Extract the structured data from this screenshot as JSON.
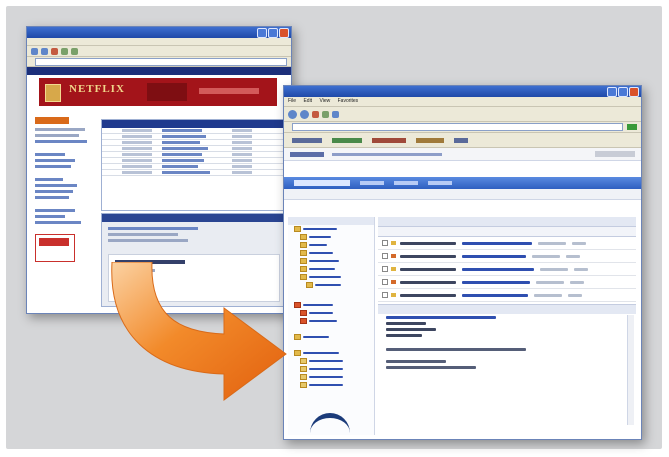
{
  "colors": {
    "netflix_red": "#a3141a",
    "window_blue": "#2a5bc4",
    "arrow_orange": "#f07a1a",
    "stage_gray": "#d5d6d8"
  },
  "netflix_window": {
    "logo_text": "NETFLIX"
  },
  "email_window": {
    "menu": [
      "File",
      "Edit",
      "View",
      "Favorites"
    ]
  }
}
